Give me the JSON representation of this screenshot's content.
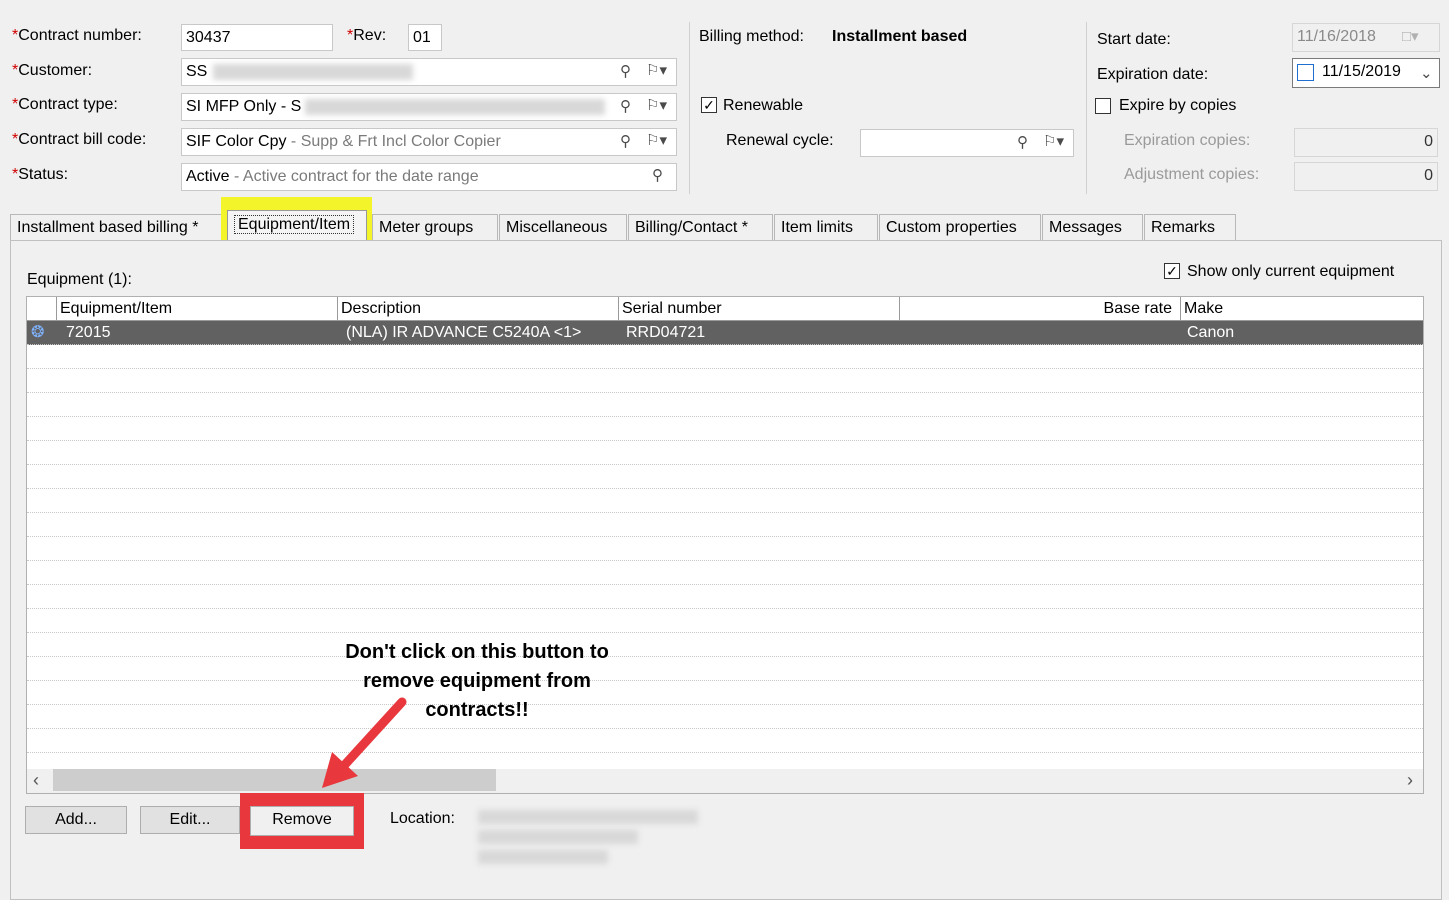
{
  "header": {
    "contract_number_label": "Contract number:",
    "contract_number_value": "30437",
    "rev_label": "Rev:",
    "rev_value": "01",
    "customer_label": "Customer:",
    "customer_value": "SS",
    "contract_type_label": "Contract type:",
    "contract_type_value": "SI MFP Only - S",
    "contract_bill_code_label": "Contract bill code:",
    "contract_bill_code_value": "SIF Color Cpy",
    "contract_bill_code_desc": " - Supp & Frt Incl Color Copier",
    "status_label": "Status:",
    "status_value": "Active",
    "status_desc": " - Active contract for the date range",
    "required_marker": "*"
  },
  "billing": {
    "method_label": "Billing method:",
    "method_value": "Installment based",
    "renewable_label": "Renewable",
    "renewable_checked": true,
    "renewal_cycle_label": "Renewal cycle:",
    "renewal_cycle_value": ""
  },
  "dates": {
    "start_label": "Start date:",
    "start_value": "11/16/2018",
    "expiration_label": "Expiration date:",
    "expiration_value": "11/15/2019",
    "expire_by_copies_label": "Expire by copies",
    "expire_by_copies_checked": false,
    "expiration_copies_label": "Expiration copies:",
    "expiration_copies_value": "0",
    "adjustment_copies_label": "Adjustment copies:",
    "adjustment_copies_value": "0"
  },
  "tabs": [
    {
      "label": "Installment based billing *"
    },
    {
      "label": "Equipment/Item"
    },
    {
      "label": "Meter groups"
    },
    {
      "label": "Miscellaneous"
    },
    {
      "label": "Billing/Contact *"
    },
    {
      "label": "Item limits"
    },
    {
      "label": "Custom properties"
    },
    {
      "label": "Messages"
    },
    {
      "label": "Remarks"
    }
  ],
  "equipment": {
    "section_label": "Equipment (1):",
    "show_current_label": "Show only current equipment",
    "show_current_checked": true,
    "columns": [
      "Equipment/Item",
      "Description",
      "Serial number",
      "Base rate",
      "Make"
    ],
    "rows": [
      {
        "item": "72015",
        "description": "(NLA) IR ADVANCE C5240A <1>",
        "serial": "RRD04721",
        "base_rate": "",
        "make": "Canon"
      }
    ]
  },
  "buttons": {
    "add": "Add...",
    "edit": "Edit...",
    "remove": "Remove",
    "location_label": "Location:"
  },
  "annotation": {
    "line1": "Don't click on this button to",
    "line2": "remove equipment from",
    "line3": "contracts!!",
    "highlight_color": "#f4f42a",
    "alert_color": "#e8383d"
  },
  "icons": {
    "lookup": "magnifier-icon",
    "flag_dropdown": "flag-dropdown-icon",
    "calendar": "calendar-icon",
    "equipment_row": "equipment-icon"
  }
}
